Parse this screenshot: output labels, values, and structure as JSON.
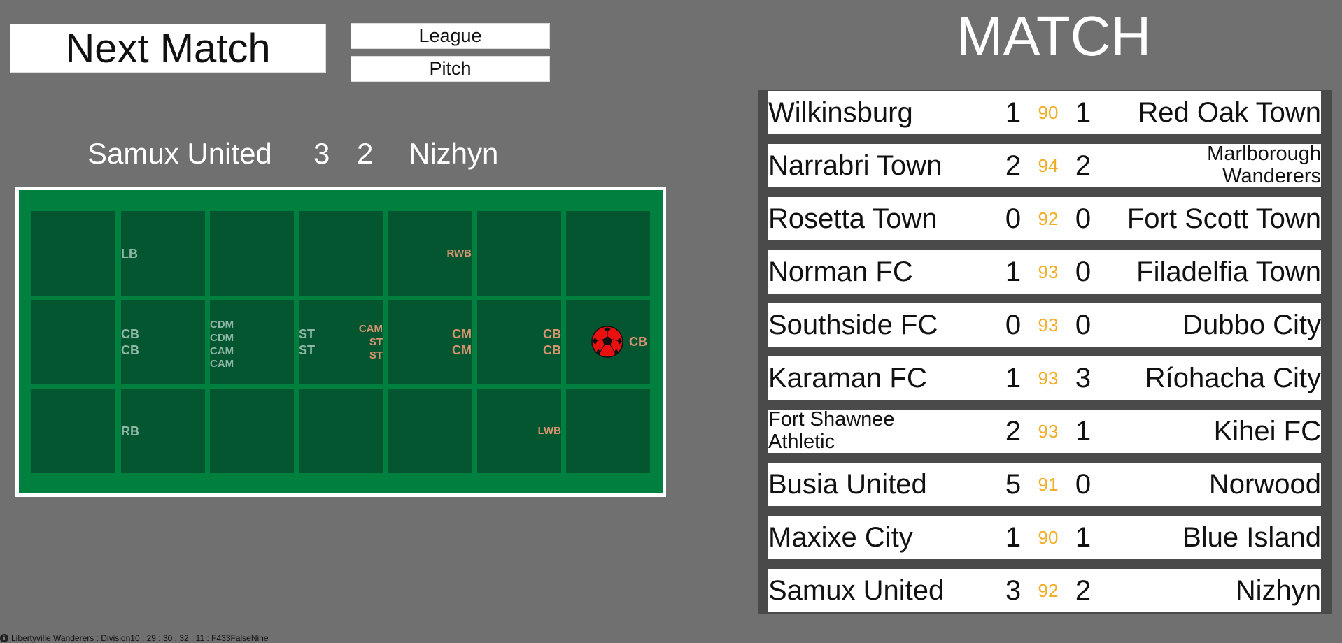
{
  "controls": {
    "next_match": "Next Match",
    "league": "League",
    "pitch": "Pitch"
  },
  "header": {
    "title": "MATCH"
  },
  "current_match": {
    "home": "Samux United",
    "home_score": "3",
    "away_score": "2",
    "away": "Nizhyn"
  },
  "pitch": {
    "home_team_labels": [
      "LB",
      "CB\nCB",
      "CDM\nCDM\nCAM\nCAM",
      "ST\nST",
      "RB"
    ],
    "away_team_labels": [
      "RWB",
      "CAM\nST\nST",
      "CM\nCM",
      "CB\nCB",
      "CB",
      "LWB"
    ],
    "ball_icon": "soccer-ball-icon",
    "colors": {
      "home_labels": "#8fb6a6",
      "away_labels": "#d79470",
      "pitch": "#00803e",
      "zone": "#035630"
    }
  },
  "results": [
    {
      "home": "Wilkinsburg",
      "home_score": "1",
      "minute": "90",
      "away_score": "1",
      "away": "Red Oak Town"
    },
    {
      "home": "Narrabri Town",
      "home_score": "2",
      "minute": "94",
      "away_score": "2",
      "away": "Marlborough Wanderers"
    },
    {
      "home": "Rosetta Town",
      "home_score": "0",
      "minute": "92",
      "away_score": "0",
      "away": "Fort Scott Town"
    },
    {
      "home": "Norman FC",
      "home_score": "1",
      "minute": "93",
      "away_score": "0",
      "away": "Filadelfia Town"
    },
    {
      "home": "Southside FC",
      "home_score": "0",
      "minute": "93",
      "away_score": "0",
      "away": "Dubbo City"
    },
    {
      "home": "Karaman FC",
      "home_score": "1",
      "minute": "93",
      "away_score": "3",
      "away": "Ríohacha City"
    },
    {
      "home": "Fort Shawnee Athletic",
      "home_score": "2",
      "minute": "93",
      "away_score": "1",
      "away": "Kihei FC"
    },
    {
      "home": "Busia United",
      "home_score": "5",
      "minute": "91",
      "away_score": "0",
      "away": "Norwood"
    },
    {
      "home": "Maxixe City",
      "home_score": "1",
      "minute": "90",
      "away_score": "1",
      "away": "Blue Island"
    },
    {
      "home": "Samux United",
      "home_score": "3",
      "minute": "92",
      "away_score": "2",
      "away": "Nizhyn"
    }
  ],
  "status_bar": {
    "icon": "info-icon",
    "text": "Libertyville Wanderers : Division10 : 29 : 30 : 32 : 11 : F433FalseNine"
  },
  "colors": {
    "background": "#707070",
    "minute": "#f0ad28",
    "table_frame": "#4a4a4a"
  }
}
